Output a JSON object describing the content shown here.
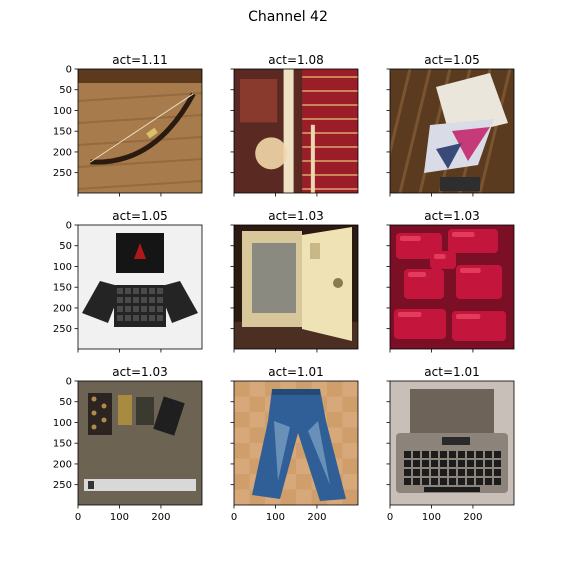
{
  "figure": {
    "title": "Channel 42"
  },
  "chart_data": {
    "type": "image-grid",
    "title": "Channel 42",
    "grid": false,
    "rows": 3,
    "cols": 3,
    "xlim": [
      0,
      299
    ],
    "ylim": [
      299,
      0
    ],
    "xticks": [
      0,
      100,
      200
    ],
    "yticks": [
      0,
      50,
      100,
      150,
      200,
      250
    ],
    "x_tick_rows": [
      2
    ],
    "y_tick_cols": [
      0
    ],
    "panels": [
      {
        "title": "act=1.11",
        "act": 1.11,
        "content": "bow",
        "colors": {
          "bg": "#a77b4c",
          "band": "#8a5f35",
          "accent": "#2a1a10"
        }
      },
      {
        "title": "act=1.08",
        "act": 1.08,
        "content": "stairs",
        "colors": {
          "bg": "#5a2a22",
          "band": "#9a1d28",
          "accent": "#f2d7a8"
        }
      },
      {
        "title": "act=1.05",
        "act": 1.05,
        "content": "desk-papers",
        "colors": {
          "bg": "#5b3b1f",
          "band": "#7a5430",
          "accent": "#c73a7a"
        }
      },
      {
        "title": "act=1.05",
        "act": 1.05,
        "content": "laptop-keyboard",
        "colors": {
          "bg": "#f1f1f1",
          "band": "#242424",
          "accent": "#b01818"
        }
      },
      {
        "title": "act=1.03",
        "act": 1.03,
        "content": "safe",
        "colors": {
          "bg": "#2a1a12",
          "band": "#d8c79a",
          "accent": "#efe2b5"
        }
      },
      {
        "title": "act=1.03",
        "act": 1.03,
        "content": "red-whistles",
        "colors": {
          "bg": "#7a0f25",
          "band": "#c4163c",
          "accent": "#e23b5b"
        }
      },
      {
        "title": "act=1.03",
        "act": 1.03,
        "content": "abacus-calculators",
        "colors": {
          "bg": "#6c6353",
          "band": "#2c2420",
          "accent": "#d8d8d8"
        }
      },
      {
        "title": "act=1.01",
        "act": 1.01,
        "content": "jeans",
        "colors": {
          "bg": "#d7a879",
          "band": "#2f5f96",
          "accent": "#8fb1d1"
        }
      },
      {
        "title": "act=1.01",
        "act": 1.01,
        "content": "typewriter",
        "colors": {
          "bg": "#c7bfb8",
          "band": "#6d6358",
          "accent": "#1c1c1c"
        }
      }
    ]
  }
}
